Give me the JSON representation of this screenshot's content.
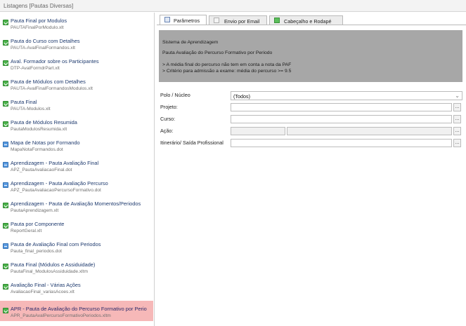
{
  "window": {
    "title": "Listagens [Pautas Diversas]"
  },
  "list": [
    {
      "title": "Pauta Final por Modulos",
      "file": "PAUTAFinalPorModulo.xlt",
      "icon": "excel-icon",
      "icon_color": "green"
    },
    {
      "title": "Pauta do Curso com Detalhes",
      "file": "PAUTA-AvalFinalFormandos.xlt",
      "icon": "excel-icon",
      "icon_color": "green"
    },
    {
      "title": "Aval. Formador sobre os Participantes",
      "file": "DTP-AvalFormdrPart.xlt",
      "icon": "excel-icon",
      "icon_color": "green"
    },
    {
      "title": "Pauta de Módulos com Detalhes",
      "file": "PAUTA-AvalFinalFormandosModulos.xlt",
      "icon": "excel-icon",
      "icon_color": "green"
    },
    {
      "title": "Pauta Final",
      "file": "PAUTA-Modulos.xlt",
      "icon": "excel-icon",
      "icon_color": "green"
    },
    {
      "title": "Pauta de Módulos Resumida",
      "file": "PautaModulosResumida.xlt",
      "icon": "excel-icon",
      "icon_color": "green"
    },
    {
      "title": "Mapa de Notas por Formando",
      "file": "MapaNotaFormandos.dot",
      "icon": "word-icon",
      "icon_color": "blue"
    },
    {
      "title": "Aprendizagem - Pauta Avaliação Final",
      "file": "APZ_PautaAvaliacaoFinal.dot",
      "icon": "word-icon",
      "icon_color": "blue"
    },
    {
      "title": "Aprendizagem - Pauta Avaliação Percurso",
      "file": "APZ_PautaAvaliacaoPercursoFormativo.dot",
      "icon": "word-icon",
      "icon_color": "blue"
    },
    {
      "title": "Aprendizagem - Pauta de Avaliação Momentos/Periodos",
      "file": "PautaAprendizagem.xlt",
      "icon": "excel-icon",
      "icon_color": "green"
    },
    {
      "title": "Pauta por Componente",
      "file": "ReportGeral.xlt",
      "icon": "excel-icon",
      "icon_color": "green"
    },
    {
      "title": "Pauta de Avaliação Final com Periodos",
      "file": "Pauta_final_periodos.dot",
      "icon": "word-icon",
      "icon_color": "blue"
    },
    {
      "title": "Pauta Final (Módulos e Assiduidade)",
      "file": "PautaFinal_ModulosAssiduidade.xltm",
      "icon": "excel-icon",
      "icon_color": "green"
    },
    {
      "title": "Avaliação Final - Várias Ações",
      "file": "AvaliacaoFinal_variasAcoes.xlt",
      "icon": "excel-icon",
      "icon_color": "green"
    },
    {
      "title": "APR - Pauta de Avaliação do Percurso Formativo por Perio",
      "file": "APR_PautaAvalPercursoFormativoPeriodos.xltm",
      "icon": "excel-icon",
      "icon_color": "green",
      "selected": true
    }
  ],
  "tabs": [
    {
      "label": "Parâmetros",
      "icon": "parameters-icon",
      "active": true
    },
    {
      "label": "Envio por Email",
      "icon": "email-icon",
      "active": false
    },
    {
      "label": "Cabeçalho e Rodapé",
      "icon": "header-footer-icon",
      "active": false
    }
  ],
  "info": {
    "line1": "Sistema de Aprendizagem",
    "line2": "Pauta Avaliação do Percurso Formativo por Periodo",
    "line3": "> A média final do percurso não tem em conta a nota da PAF",
    "line4": "> Critério para admissão a exame: média do percurso >= 9.5"
  },
  "form": {
    "polo_label": "Polo / Núcleo",
    "polo_value": "(Todos)",
    "projeto_label": "Projeto:",
    "curso_label": "Curso:",
    "acao_label": "Ação:",
    "itinerario_label": "Itinerário/ Saída Profissional",
    "browse_label": "...",
    "chevron": "⌄"
  },
  "colors": {
    "selected_item": "#f6b8b8",
    "info_panel": "#a7a7a7",
    "excel_icon": "#4bb24b",
    "word_icon": "#5b9be0"
  }
}
